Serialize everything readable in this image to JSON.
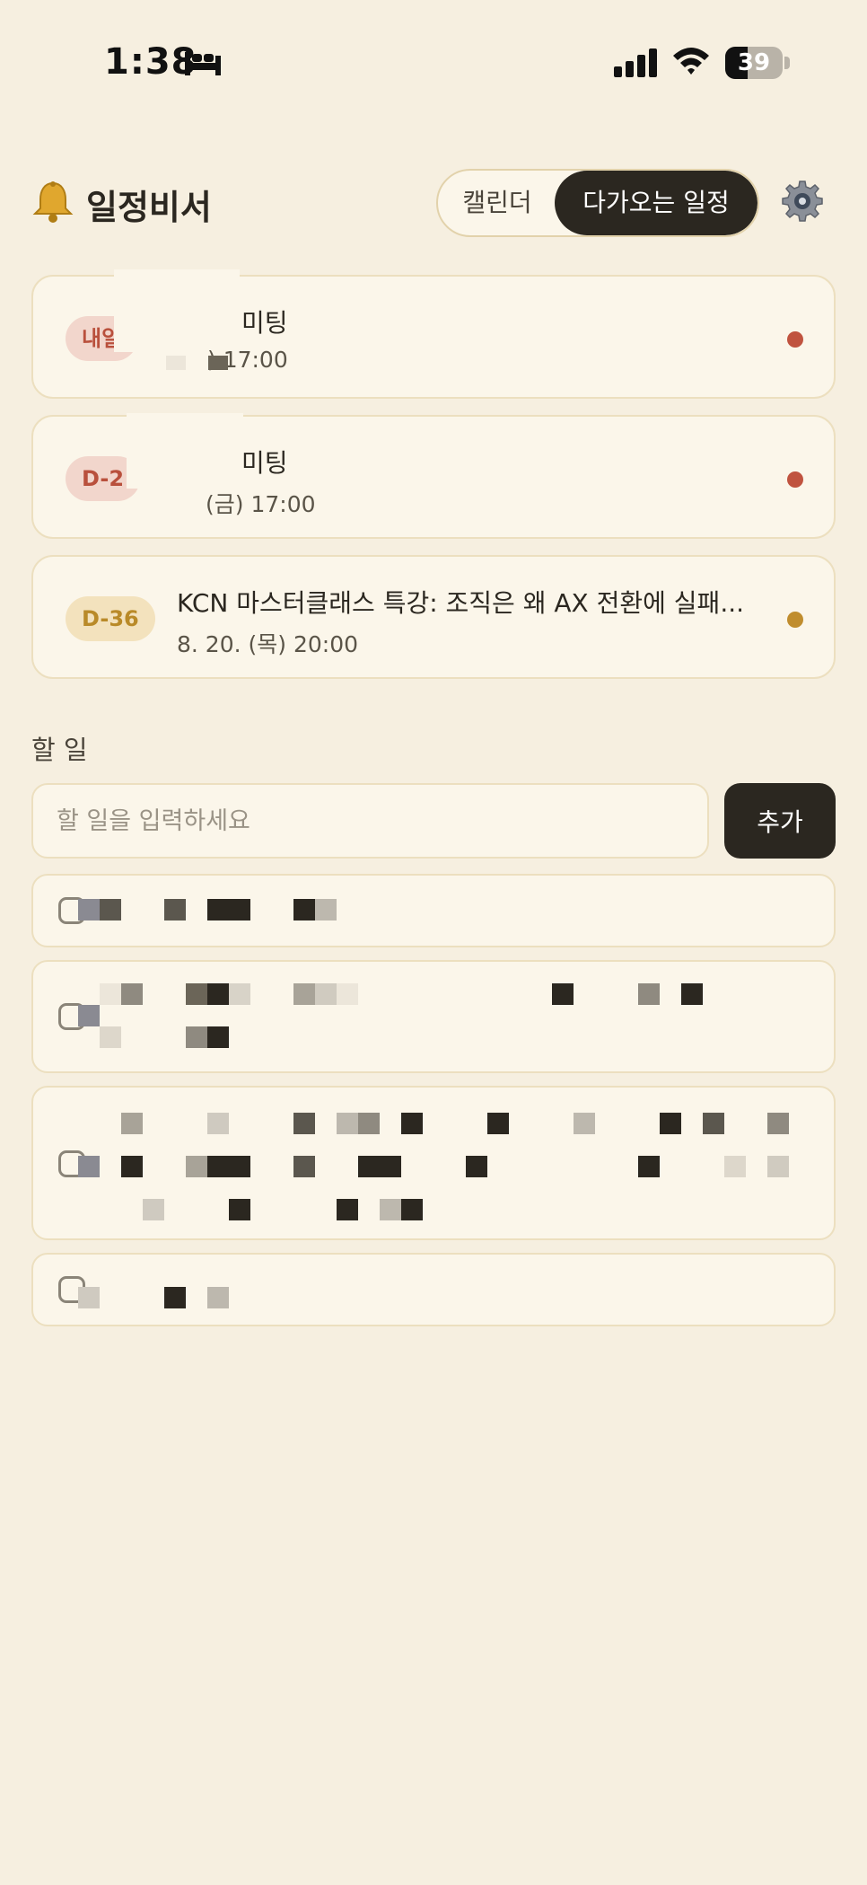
{
  "status_bar": {
    "time": "1:38",
    "battery_level": "39",
    "battery_fraction": 0.39
  },
  "header": {
    "title": "일정비서",
    "bell_icon": "bell-icon",
    "tabs": [
      {
        "label": "캘린더",
        "selected": false
      },
      {
        "label": "다가오는 일정",
        "selected": true
      }
    ],
    "settings_icon": "gear-icon"
  },
  "events": [
    {
      "badge": "내일",
      "title": "미팅",
      "time": ") 17:00",
      "dot_color": "#c0533f",
      "badge_color": "#b9503c"
    },
    {
      "badge": "D-2",
      "title": "미팅",
      "time": "(금) 17:00",
      "dot_color": "#c0533f",
      "badge_color": "#b9503c"
    },
    {
      "badge": "D-36",
      "title": "KCN 마스터클래스 특강: 조직은 왜 AX 전환에 실패...",
      "time": "8. 20. (목) 20:00",
      "dot_color": "#c08d2e",
      "badge_color": "#b98a28"
    }
  ],
  "todo": {
    "heading": "할 일",
    "input_placeholder": "할 일을 입력하세요",
    "add_label": "추가",
    "items": [
      {
        "text": "",
        "checked": false
      },
      {
        "text": "",
        "checked": false
      },
      {
        "text": "",
        "checked": false
      },
      {
        "text": "",
        "checked": false
      }
    ]
  }
}
